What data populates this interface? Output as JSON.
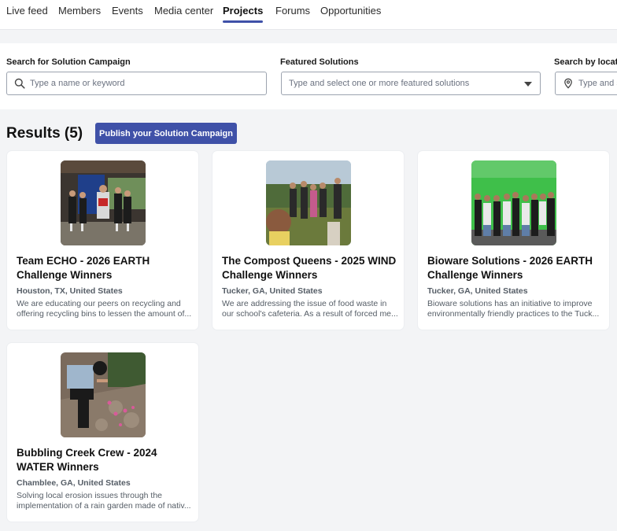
{
  "nav": {
    "items": [
      {
        "label": "Live feed"
      },
      {
        "label": "Members"
      },
      {
        "label": "Events"
      },
      {
        "label": "Media center"
      },
      {
        "label": "Projects",
        "active": true
      },
      {
        "label": "Forums"
      },
      {
        "label": "Opportunities"
      }
    ]
  },
  "filters": {
    "search": {
      "label": "Search for Solution Campaign",
      "placeholder": "Type a name or keyword",
      "icon": "search-icon"
    },
    "featured": {
      "label": "Featured Solutions",
      "placeholder": "Type and select one or more featured solutions",
      "icon": "chevron-down-icon"
    },
    "location": {
      "label": "Search by locat",
      "placeholder": "Type and s",
      "icon": "location-pin-icon"
    }
  },
  "results": {
    "title": "Results (5)",
    "publish_label": "Publish your Solution Campaign"
  },
  "accent_color": "#3f51a8",
  "cards": [
    {
      "title": "Team ECHO - 2026 EARTH Challenge Winners",
      "location": "Houston, TX, United States",
      "description": "We are educating our peers on recycling and offering recycling bins to lessen the amount of..."
    },
    {
      "title": "The Compost Queens - 2025 WIND Challenge Winners",
      "location": "Tucker, GA, United States",
      "description": "We are addressing the issue of food waste in our school's cafeteria. As a result of forced me..."
    },
    {
      "title": "Bioware Solutions - 2026 EARTH Challenge Winners",
      "location": "Tucker, GA, United States",
      "description": "Bioware solutions has an initiative to improve environmentally friendly practices to the Tuck..."
    },
    {
      "title": "Bubbling Creek Crew - 2024 WATER Winners",
      "location": "Chamblee, GA, United States",
      "description": "Solving local erosion issues through the implementation of a rain garden made of nativ..."
    }
  ]
}
